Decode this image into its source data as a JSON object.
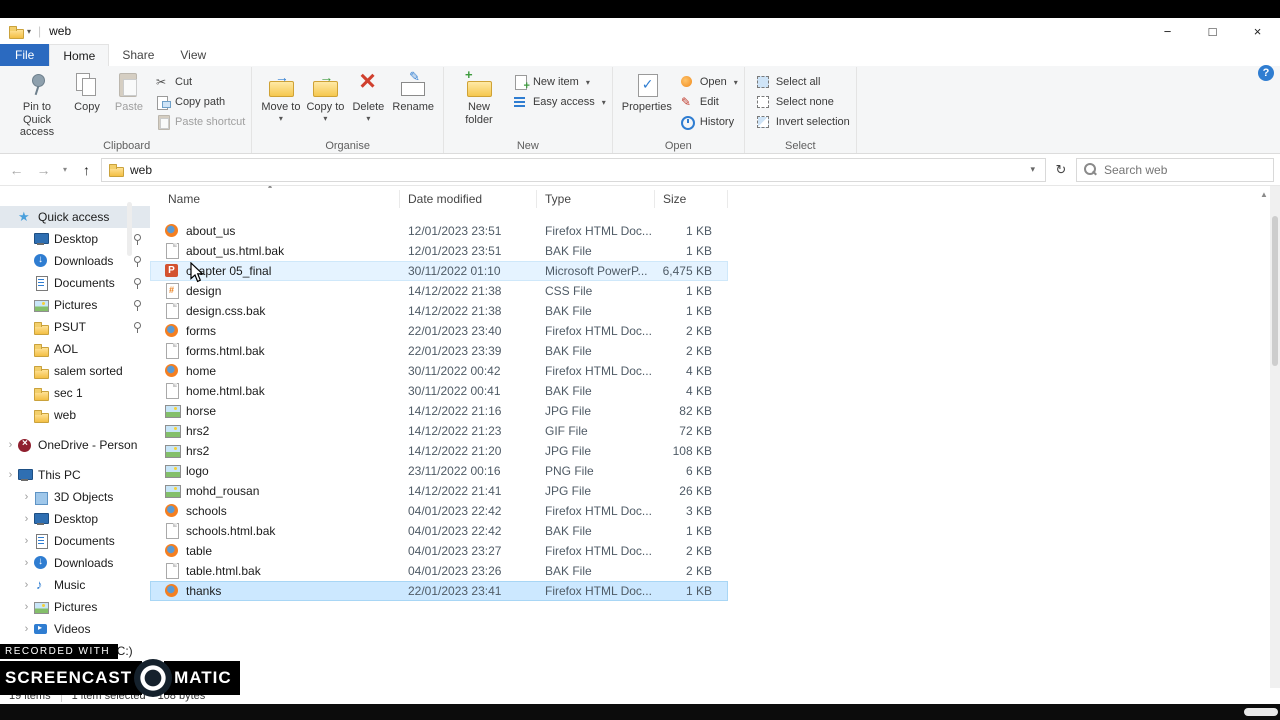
{
  "colors": {
    "file-tab": "#2b6ac0",
    "accent": "#2f7dd1",
    "selection": "#cce8ff",
    "hover": "#e5f3ff",
    "delete-red": "#d0402e"
  },
  "window": {
    "title": "web",
    "minimize_glyph": "−",
    "maximize_glyph": "□",
    "close_glyph": "×",
    "help_glyph": "?"
  },
  "tabs": [
    {
      "label": "File",
      "style": "file"
    },
    {
      "label": "Home",
      "style": "active"
    },
    {
      "label": "Share",
      "style": ""
    },
    {
      "label": "View",
      "style": ""
    }
  ],
  "ribbon": {
    "groups": [
      {
        "label": "Clipboard",
        "large": [
          {
            "label": "Pin to Quick access",
            "icon": "pin"
          },
          {
            "label": "Copy",
            "icon": "copy"
          },
          {
            "label": "Paste",
            "icon": "paste",
            "disabled": true
          }
        ],
        "small": [
          {
            "label": "Cut",
            "icon": "cut"
          },
          {
            "label": "Copy path",
            "icon": "copy-path"
          },
          {
            "label": "Paste shortcut",
            "icon": "paste-shortcut",
            "disabled": true
          }
        ]
      },
      {
        "label": "Organise",
        "large": [
          {
            "label": "Move to",
            "icon": "move-to",
            "dropdown": true
          },
          {
            "label": "Copy to",
            "icon": "copy-to",
            "dropdown": true
          },
          {
            "label": "Delete",
            "icon": "delete",
            "dropdown": true
          },
          {
            "label": "Rename",
            "icon": "rename"
          }
        ],
        "small": []
      },
      {
        "label": "New",
        "large": [
          {
            "label": "New folder",
            "icon": "new-folder"
          }
        ],
        "small": [
          {
            "label": "New item",
            "icon": "new-item",
            "dropdown": true
          },
          {
            "label": "Easy access",
            "icon": "easy-access",
            "dropdown": true
          }
        ]
      },
      {
        "label": "Open",
        "large": [
          {
            "label": "Properties",
            "icon": "properties"
          }
        ],
        "small": [
          {
            "label": "Open",
            "icon": "open-item",
            "dropdown": true
          },
          {
            "label": "Edit",
            "icon": "edit"
          },
          {
            "label": "History",
            "icon": "history"
          }
        ]
      },
      {
        "label": "Select",
        "large": [],
        "small": [
          {
            "label": "Select all",
            "icon": "select-all"
          },
          {
            "label": "Select none",
            "icon": "select-none"
          },
          {
            "label": "Invert selection",
            "icon": "invert-selection"
          }
        ]
      }
    ]
  },
  "address_bar": {
    "back_glyph": "←",
    "forward_glyph": "→",
    "recent_glyph": "▾",
    "up_glyph": "↑",
    "path": "web",
    "dropdown_glyph": "▾",
    "refresh_glyph": "↻",
    "search_placeholder": "Search web"
  },
  "sidebar": {
    "items": [
      {
        "label": "Quick access",
        "icon": "star",
        "level": 0,
        "chevron": "",
        "highlight": true
      },
      {
        "label": "Desktop",
        "icon": "desktop",
        "level": 1,
        "pin": true
      },
      {
        "label": "Downloads",
        "icon": "downloads",
        "level": 1,
        "pin": true
      },
      {
        "label": "Documents",
        "icon": "documents",
        "level": 1,
        "pin": true
      },
      {
        "label": "Pictures",
        "icon": "pictures",
        "level": 1,
        "pin": true
      },
      {
        "label": "PSUT",
        "icon": "folder",
        "level": 1,
        "pin": true
      },
      {
        "label": "AOL",
        "icon": "folder",
        "level": 1
      },
      {
        "label": "salem sorted",
        "icon": "folder",
        "level": 1
      },
      {
        "label": "sec 1",
        "icon": "folder",
        "level": 1
      },
      {
        "label": "web",
        "icon": "folder",
        "level": 1
      },
      {
        "label": "OneDrive - Person",
        "icon": "onedrive",
        "level": 0,
        "chevron": "›",
        "gap": true
      },
      {
        "label": "This PC",
        "icon": "pc",
        "level": 0,
        "chevron": "›",
        "gap": true
      },
      {
        "label": "3D Objects",
        "icon": "3d",
        "level": 1,
        "chevron": "›"
      },
      {
        "label": "Desktop",
        "icon": "desktop",
        "level": 1,
        "chevron": "›"
      },
      {
        "label": "Documents",
        "icon": "documents",
        "level": 1,
        "chevron": "›"
      },
      {
        "label": "Downloads",
        "icon": "downloads",
        "level": 1,
        "chevron": "›"
      },
      {
        "label": "Music",
        "icon": "music",
        "level": 1,
        "chevron": "›"
      },
      {
        "label": "Pictures",
        "icon": "pictures",
        "level": 1,
        "chevron": "›"
      },
      {
        "label": "Videos",
        "icon": "videos",
        "level": 1,
        "chevron": "›"
      },
      {
        "label": "Local Disk (C:)",
        "icon": "disk",
        "level": 1,
        "chevron": "›"
      }
    ]
  },
  "file_list": {
    "columns": [
      "Name",
      "Date modified",
      "Type",
      "Size"
    ],
    "files": [
      {
        "name": "about_us",
        "date": "12/01/2023 23:51",
        "type": "Firefox HTML Doc...",
        "size": "1 KB",
        "icon": "firefox"
      },
      {
        "name": "about_us.html.bak",
        "date": "12/01/2023 23:51",
        "type": "BAK File",
        "size": "1 KB",
        "icon": "bak"
      },
      {
        "name": "chapter 05_final",
        "date": "30/11/2022 01:10",
        "type": "Microsoft PowerP...",
        "size": "6,475 KB",
        "icon": "ppt",
        "state": "hover"
      },
      {
        "name": "design",
        "date": "14/12/2022 21:38",
        "type": "CSS File",
        "size": "1 KB",
        "icon": "css"
      },
      {
        "name": "design.css.bak",
        "date": "14/12/2022 21:38",
        "type": "BAK File",
        "size": "1 KB",
        "icon": "bak"
      },
      {
        "name": "forms",
        "date": "22/01/2023 23:40",
        "type": "Firefox HTML Doc...",
        "size": "2 KB",
        "icon": "firefox"
      },
      {
        "name": "forms.html.bak",
        "date": "22/01/2023 23:39",
        "type": "BAK File",
        "size": "2 KB",
        "icon": "bak"
      },
      {
        "name": "home",
        "date": "30/11/2022 00:42",
        "type": "Firefox HTML Doc...",
        "size": "4 KB",
        "icon": "firefox"
      },
      {
        "name": "home.html.bak",
        "date": "30/11/2022 00:41",
        "type": "BAK File",
        "size": "4 KB",
        "icon": "bak"
      },
      {
        "name": "horse",
        "date": "14/12/2022 21:16",
        "type": "JPG File",
        "size": "82 KB",
        "icon": "img"
      },
      {
        "name": "hrs2",
        "date": "14/12/2022 21:23",
        "type": "GIF File",
        "size": "72 KB",
        "icon": "img"
      },
      {
        "name": "hrs2",
        "date": "14/12/2022 21:20",
        "type": "JPG File",
        "size": "108 KB",
        "icon": "img"
      },
      {
        "name": "logo",
        "date": "23/11/2022 00:16",
        "type": "PNG File",
        "size": "6 KB",
        "icon": "img"
      },
      {
        "name": "mohd_rousan",
        "date": "14/12/2022 21:41",
        "type": "JPG File",
        "size": "26 KB",
        "icon": "img"
      },
      {
        "name": "schools",
        "date": "04/01/2023 22:42",
        "type": "Firefox HTML Doc...",
        "size": "3 KB",
        "icon": "firefox"
      },
      {
        "name": "schools.html.bak",
        "date": "04/01/2023 22:42",
        "type": "BAK File",
        "size": "1 KB",
        "icon": "bak"
      },
      {
        "name": "table",
        "date": "04/01/2023 23:27",
        "type": "Firefox HTML Doc...",
        "size": "2 KB",
        "icon": "firefox"
      },
      {
        "name": "table.html.bak",
        "date": "04/01/2023 23:26",
        "type": "BAK File",
        "size": "2 KB",
        "icon": "bak"
      },
      {
        "name": "thanks",
        "date": "22/01/2023 23:41",
        "type": "Firefox HTML Doc...",
        "size": "1 KB",
        "icon": "firefox",
        "state": "selected"
      }
    ]
  },
  "status_bar": {
    "items": "19 items",
    "selection": "1 item selected",
    "selection_size": "108 bytes"
  },
  "watermark": {
    "line1": "RECORDED WITH",
    "brand_left": "SCREENCAST",
    "brand_right": "MATIC"
  }
}
